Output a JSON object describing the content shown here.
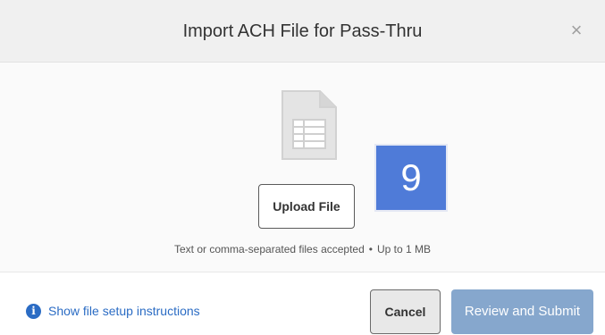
{
  "header": {
    "title": "Import ACH File for Pass-Thru",
    "close_glyph": "×",
    "close_icon": "close-icon"
  },
  "body": {
    "file_icon": "spreadsheet-file-icon",
    "upload_label": "Upload File",
    "step_badge": "9",
    "accepted_types": "Text or comma-separated files accepted",
    "separator": "•",
    "size_limit": "Up to 1 MB"
  },
  "footer": {
    "info_icon": "info-icon",
    "info_glyph": "i",
    "instructions_link": "Show file setup instructions",
    "cancel_label": "Cancel",
    "submit_label": "Review and Submit"
  },
  "colors": {
    "header_bg": "#f0f0f0",
    "body_bg": "#fafafa",
    "badge_blue": "#4f7bd8",
    "link_blue": "#2b6cc4",
    "submit_disabled": "#86a7cd"
  }
}
